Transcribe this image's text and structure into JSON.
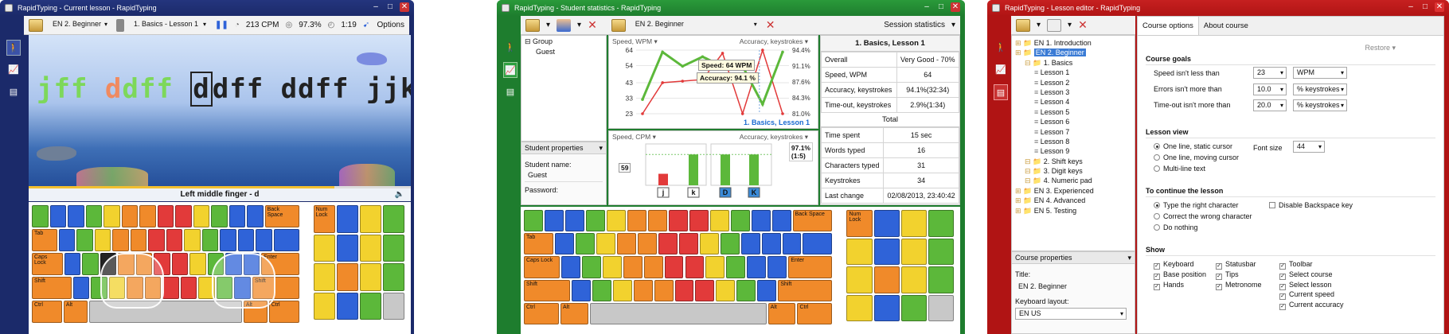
{
  "colors": {
    "win1": "#1b2a6a",
    "win2": "#1e7d2e",
    "win3": "#b01414",
    "finger_red": "#e23a3a",
    "finger_green": "#5cb83a"
  },
  "win1": {
    "title": "RapidTyping - Current lesson - RapidTyping",
    "course": "EN 2. Beginner",
    "lesson": "1. Basics - Lesson 1",
    "speed": "213 CPM",
    "accuracy": "97.3%",
    "time": "1:19",
    "options": "Options",
    "typed_green": "jff ",
    "typed_red": "d",
    "typed_green2": "dff ",
    "cursor_char": "d",
    "remaining": "dff ddff jjkk jjk",
    "hint": "Left middle finger - d",
    "keys": {
      "backspace": "Back Space",
      "tab": "Tab",
      "capslock": "Caps Lock",
      "enter": "Enter",
      "shift": "Shift",
      "ctrl": "Ctrl",
      "alt": "Alt",
      "numlock": "Num Lock"
    }
  },
  "win2": {
    "title": "RapidTyping - Student statistics - RapidTyping",
    "course": "EN 2. Beginner",
    "session_stats": "Session statistics",
    "tree": [
      "Group",
      "Guest"
    ],
    "student_props": "Student properties",
    "student_name_label": "Student name:",
    "student_name": "Guest",
    "password_label": "Password:",
    "chart1": {
      "left_label": "Speed, WPM",
      "right_label": "Accuracy, keystrokes",
      "caption": "1. Basics, Lesson 1",
      "tooltip_speed": "Speed: 64 WPM",
      "tooltip_acc": "Accuracy: 94.1 %"
    },
    "chart2": {
      "left_label": "Speed, CPM",
      "right_label": "Accuracy, keystrokes",
      "value": "59",
      "acc_value": "97.1%",
      "acc_count": "(1:5)",
      "keys": [
        "j",
        "k",
        "D",
        "K"
      ]
    },
    "summary": {
      "title": "1. Basics, Lesson 1",
      "rows": [
        [
          "Overall",
          "Very Good - 70%"
        ],
        [
          "Speed, WPM",
          "64"
        ],
        [
          "Accuracy, keystrokes",
          "94.1%(32:34)"
        ],
        [
          "Time-out, keystrokes",
          "2.9%(1:34)"
        ]
      ],
      "total": "Total",
      "rows2": [
        [
          "Time spent",
          "15 sec"
        ],
        [
          "Words typed",
          "16"
        ],
        [
          "Characters typed",
          "31"
        ],
        [
          "Keystrokes",
          "34"
        ],
        [
          "Last change",
          "02/08/2013, 23:40:42"
        ]
      ]
    }
  },
  "chart_data": [
    {
      "type": "line",
      "title": "1. Basics, Lesson 1",
      "ylabel": "Speed, WPM",
      "y2label": "Accuracy, keystrokes",
      "yticks": [
        23,
        33,
        43,
        54,
        64
      ],
      "y2ticks": [
        "81.0%",
        "84.3%",
        "87.6%",
        "91.1%",
        "94.4%"
      ],
      "series": [
        {
          "name": "Speed, WPM",
          "values": [
            23,
            43,
            44,
            45,
            62,
            23,
            64,
            23
          ]
        },
        {
          "name": "Accuracy, keystrokes",
          "values": [
            84,
            94,
            91,
            93,
            91,
            91,
            83,
            94
          ]
        }
      ]
    },
    {
      "type": "bar",
      "ylabel": "Speed, CPM",
      "y2label": "Accuracy, keystrokes",
      "categories": [
        "j",
        "k",
        "D",
        "K"
      ],
      "values": [
        22,
        59,
        59,
        59
      ]
    }
  ],
  "win3": {
    "title": "RapidTyping - Lesson editor - RapidTyping",
    "tabs": [
      "Course options",
      "About course"
    ],
    "restore": "Restore",
    "tree": [
      {
        "t": "EN 1. Introduction",
        "lvl": 0
      },
      {
        "t": "EN 2. Beginner",
        "lvl": 0,
        "sel": true
      },
      {
        "t": "1. Basics",
        "lvl": 1
      },
      {
        "t": "Lesson 1",
        "lvl": 2
      },
      {
        "t": "Lesson 2",
        "lvl": 2
      },
      {
        "t": "Lesson 3",
        "lvl": 2
      },
      {
        "t": "Lesson 4",
        "lvl": 2
      },
      {
        "t": "Lesson 5",
        "lvl": 2
      },
      {
        "t": "Lesson 6",
        "lvl": 2
      },
      {
        "t": "Lesson 7",
        "lvl": 2
      },
      {
        "t": "Lesson 8",
        "lvl": 2
      },
      {
        "t": "Lesson 9",
        "lvl": 2
      },
      {
        "t": "2. Shift keys",
        "lvl": 1
      },
      {
        "t": "3. Digit keys",
        "lvl": 1
      },
      {
        "t": "4. Numeric pad",
        "lvl": 1
      },
      {
        "t": "EN 3. Experienced",
        "lvl": 0
      },
      {
        "t": "EN 4. Advanced",
        "lvl": 0
      },
      {
        "t": "EN 5. Testing",
        "lvl": 0
      }
    ],
    "course_props": "Course properties",
    "title_label": "Title:",
    "title_value": "EN 2. Beginner",
    "layout_label": "Keyboard layout:",
    "layout_value": "EN US",
    "goals": {
      "head": "Course goals",
      "speed_label": "Speed isn't less than",
      "speed_val": "23",
      "speed_unit": "WPM",
      "err_label": "Errors isn't more than",
      "err_val": "10.0",
      "err_unit": "% keystrokes",
      "to_label": "Time-out isn't more than",
      "to_val": "20.0",
      "to_unit": "% keystrokes"
    },
    "view": {
      "head": "Lesson view",
      "opts": [
        "One line, static cursor",
        "One line, moving cursor",
        "Multi-line text"
      ],
      "font_label": "Font size",
      "font_val": "44"
    },
    "cont": {
      "head": "To continue the lesson",
      "opts": [
        "Type the right character",
        "Correct the wrong character",
        "Do nothing"
      ],
      "backspace": "Disable Backspace key"
    },
    "show": {
      "head": "Show",
      "col1": [
        "Keyboard",
        "Base position",
        "Hands"
      ],
      "col2": [
        "Statusbar",
        "Tips",
        "Metronome"
      ],
      "col3": [
        "Toolbar",
        "Select course",
        "Select lesson",
        "Current speed",
        "Current accuracy"
      ]
    }
  }
}
